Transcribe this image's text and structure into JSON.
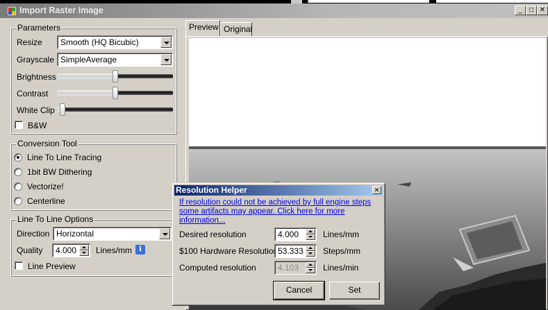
{
  "window": {
    "title": "Import Raster Image",
    "controls": {
      "minimize": "_",
      "maximize": "□",
      "close": "✕"
    }
  },
  "parameters": {
    "group_title": "Parameters",
    "resize": {
      "label": "Resize",
      "value": "Smooth (HQ Bicubic)"
    },
    "grayscale": {
      "label": "Grayscale",
      "value": "SimpleAverage"
    },
    "brightness": {
      "label": "Brightness",
      "level": 0.5
    },
    "contrast": {
      "label": "Contrast",
      "level": 0.5
    },
    "white_clip": {
      "label": "White Clip",
      "level": 0.05
    },
    "bw": {
      "label": "B&W",
      "checked": false
    }
  },
  "conversion_tool": {
    "group_title": "Conversion Tool",
    "options": [
      {
        "label": "Line To Line Tracing",
        "selected": true
      },
      {
        "label": "1bit BW Dithering",
        "selected": false
      },
      {
        "label": "Vectorize!",
        "selected": false
      },
      {
        "label": "Centerline",
        "selected": false
      }
    ]
  },
  "line_options": {
    "group_title": "Line To Line Options",
    "direction": {
      "label": "Direction",
      "value": "Horizontal"
    },
    "quality": {
      "label": "Quality",
      "value": "4.000",
      "unit": "Lines/mm"
    },
    "info_icon": "i",
    "line_preview": {
      "label": "Line Preview",
      "checked": false
    }
  },
  "tabs": [
    {
      "label": "Preview",
      "active": true
    },
    {
      "label": "Original",
      "active": false
    }
  ],
  "resolution_helper": {
    "title": "Resolution Helper",
    "close": "✕",
    "link": "If resolution could not be achieved by full engine steps some artifacts may appear. Click here for more information...",
    "desired": {
      "label": "Desired resolution",
      "value": "4.000",
      "unit": "Lines/mm"
    },
    "hardware": {
      "label": "$100 Hardware Resolution",
      "value": "53.333",
      "unit": "Steps/mm"
    },
    "computed": {
      "label": "Computed resolution",
      "value": "4.103",
      "unit": "Lines/min"
    },
    "cancel_label": "Cancel",
    "set_label": "Set"
  }
}
